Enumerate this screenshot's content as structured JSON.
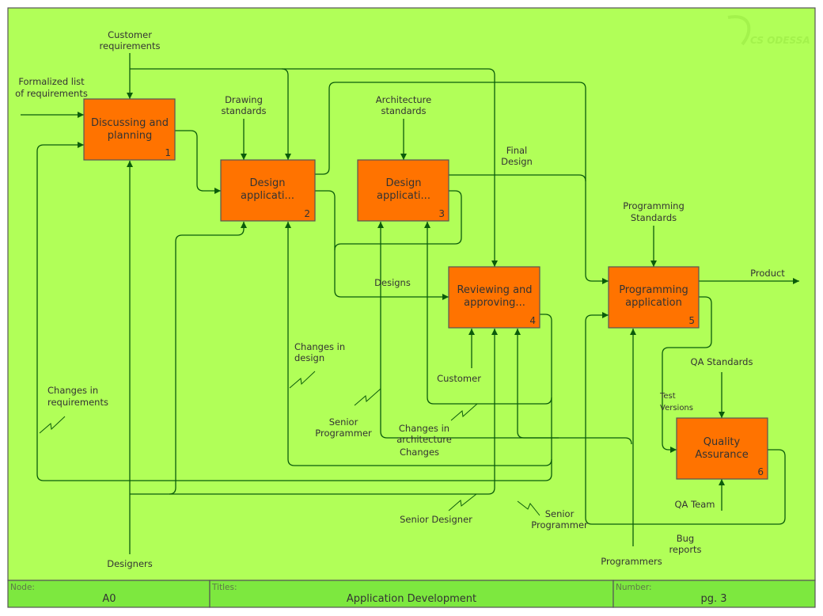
{
  "diagram": {
    "logo_text": "CS ODESSA",
    "colors": {
      "background": "#b1ff58",
      "activity_box": "#ff7300",
      "arrow": "#0b5c0b",
      "footer": "#7de83f"
    },
    "activities": [
      {
        "id": "1",
        "lines": [
          "Discussing and",
          "planning"
        ]
      },
      {
        "id": "2",
        "lines": [
          "Design",
          "applicati..."
        ]
      },
      {
        "id": "3",
        "lines": [
          "Design",
          "applicati..."
        ]
      },
      {
        "id": "4",
        "lines": [
          "Reviewing and",
          "approving..."
        ]
      },
      {
        "id": "5",
        "lines": [
          "Programming",
          "application"
        ]
      },
      {
        "id": "6",
        "lines": [
          "Quality",
          "Assurance"
        ]
      }
    ],
    "arrow_labels": {
      "customer_requirements": [
        "Customer",
        "requirements"
      ],
      "formalized_list": [
        "Formalized list",
        "of requirements"
      ],
      "drawing_standards": [
        "Drawing",
        "standards"
      ],
      "architecture_standards": [
        "Architecture",
        "standards"
      ],
      "final_design": [
        "Final",
        "Design"
      ],
      "programming_standards": [
        "Programming",
        "Standards"
      ],
      "product": "Product",
      "designs": "Designs",
      "changes_in_design": [
        "Changes in",
        "design"
      ],
      "changes_in_requirements": [
        "Changes in",
        "requirements"
      ],
      "customer": "Customer",
      "senior_programmer_1": [
        "Senior",
        "Programmer"
      ],
      "changes_in_architecture": [
        "Changes in",
        "architecture",
        "Changes"
      ],
      "senior_designer": "Senior Designer",
      "senior_programmer_2": [
        "Senior",
        "Programmer"
      ],
      "qa_standards": "QA Standards",
      "test_versions": [
        "Test",
        "Versions"
      ],
      "qa_team": "QA Team",
      "bug_reports": [
        "Bug",
        "reports"
      ],
      "programmers": "Programmers",
      "designers": "Designers"
    }
  },
  "footer": {
    "node_caption": "Node:",
    "node_value": "A0",
    "titles_caption": "Titles:",
    "titles_value": "Application Development",
    "number_caption": "Number:",
    "number_value": "pg. 3"
  }
}
